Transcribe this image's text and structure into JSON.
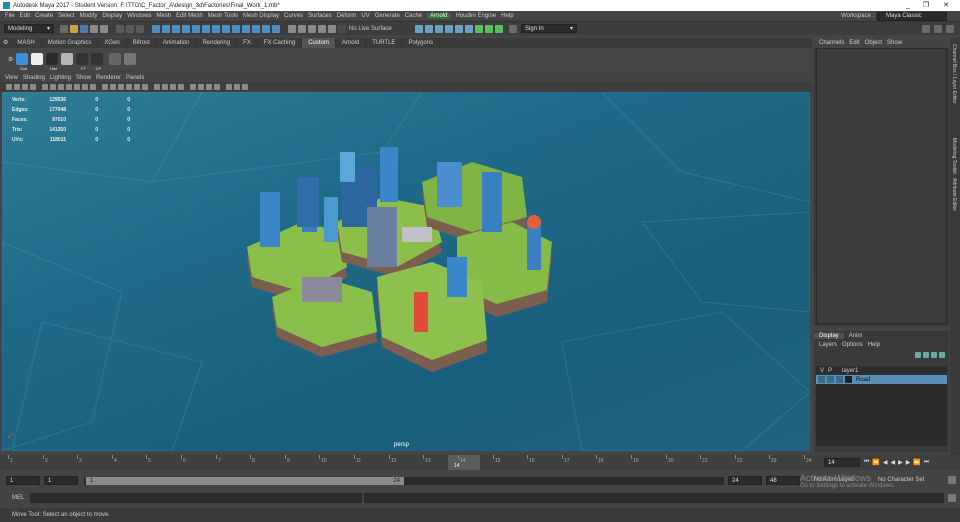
{
  "window": {
    "title": "Autodesk Maya 2017 - Student Version: F:\\TTG\\C_Factor_A\\design_3d\\Factories\\Final_Work_1.mb*",
    "controls": [
      "_",
      "❐",
      "✕"
    ]
  },
  "menubar": {
    "items": [
      "File",
      "Edit",
      "Create",
      "Select",
      "Modify",
      "Display",
      "Windows",
      "Mesh",
      "Edit Mesh",
      "Mesh Tools",
      "Mesh Display",
      "Curves",
      "Surfaces",
      "Deform",
      "UV",
      "Generate",
      "Cache"
    ],
    "plugin": "Arnold",
    "items_after": [
      "Houdini Engine",
      "Help"
    ],
    "workspace_label": "Workspace :",
    "workspace_value": "Maya Classic"
  },
  "statusline": {
    "menu_set": "Modeling",
    "live_surface": "No Live Surface",
    "sign_in": "Sign In"
  },
  "shelf": {
    "tabs": [
      "MASH",
      "Motion Graphics",
      "XGen",
      "Bifrost",
      "Animation",
      "Rendering",
      "FX",
      "FX Caching",
      "Custom",
      "Arnold",
      "TURTLE",
      "Polygons"
    ],
    "active_tab": "Custom",
    "icon_labels": [
      "",
      "Oult",
      "",
      "Hist",
      "",
      "FT",
      "CP",
      "",
      ""
    ]
  },
  "panel": {
    "menu": [
      "View",
      "Shading",
      "Lighting",
      "Show",
      "Renderer",
      "Panels"
    ],
    "camera": "persp"
  },
  "hud": {
    "rows": [
      {
        "label": "Verts:",
        "a": "129536",
        "b": "0",
        "c": "0"
      },
      {
        "label": "Edges:",
        "a": "177048",
        "b": "0",
        "c": "0"
      },
      {
        "label": "Faces:",
        "a": "97010",
        "b": "0",
        "c": "0"
      },
      {
        "label": "Tris:",
        "a": "141350",
        "b": "0",
        "c": "0"
      },
      {
        "label": "UVs:",
        "a": "118011",
        "b": "0",
        "c": "0"
      }
    ]
  },
  "channelbox": {
    "menu": [
      "Channels",
      "Edit",
      "Object",
      "Show"
    ]
  },
  "sidetabs": [
    "Channel Box / Layer Editor",
    "Modeling Toolkit",
    "Attribute Editor"
  ],
  "layers": {
    "tabs": [
      "Display",
      "Anim"
    ],
    "active_tab": "Display",
    "menu": [
      "Layers",
      "Options",
      "Help"
    ],
    "header": {
      "v": "V",
      "p": "P",
      "name": "layer1"
    },
    "rows": [
      {
        "v": "V",
        "p": "",
        "name": "Road"
      }
    ]
  },
  "timeslider": {
    "ticks": [
      "1",
      "2",
      "3",
      "4",
      "5",
      "6",
      "7",
      "8",
      "9",
      "10",
      "11",
      "12",
      "13",
      "14",
      "15",
      "16",
      "17",
      "18",
      "19",
      "20",
      "21",
      "22",
      "23",
      "24"
    ],
    "current_frame": "14",
    "current_field": "14"
  },
  "range": {
    "start": "1",
    "start_inner": "1",
    "slider_start": "1",
    "slider_end": "24",
    "end_inner": "24",
    "end": "48",
    "anim_layer": "No Anim Layer",
    "char_set": "No Character Set"
  },
  "cmdline": {
    "label": "MEL"
  },
  "helpline": {
    "text": "Move Tool: Select an object to move."
  },
  "watermark": {
    "line1": "Activate Windows",
    "line2": "Go to Settings to activate Windows."
  }
}
